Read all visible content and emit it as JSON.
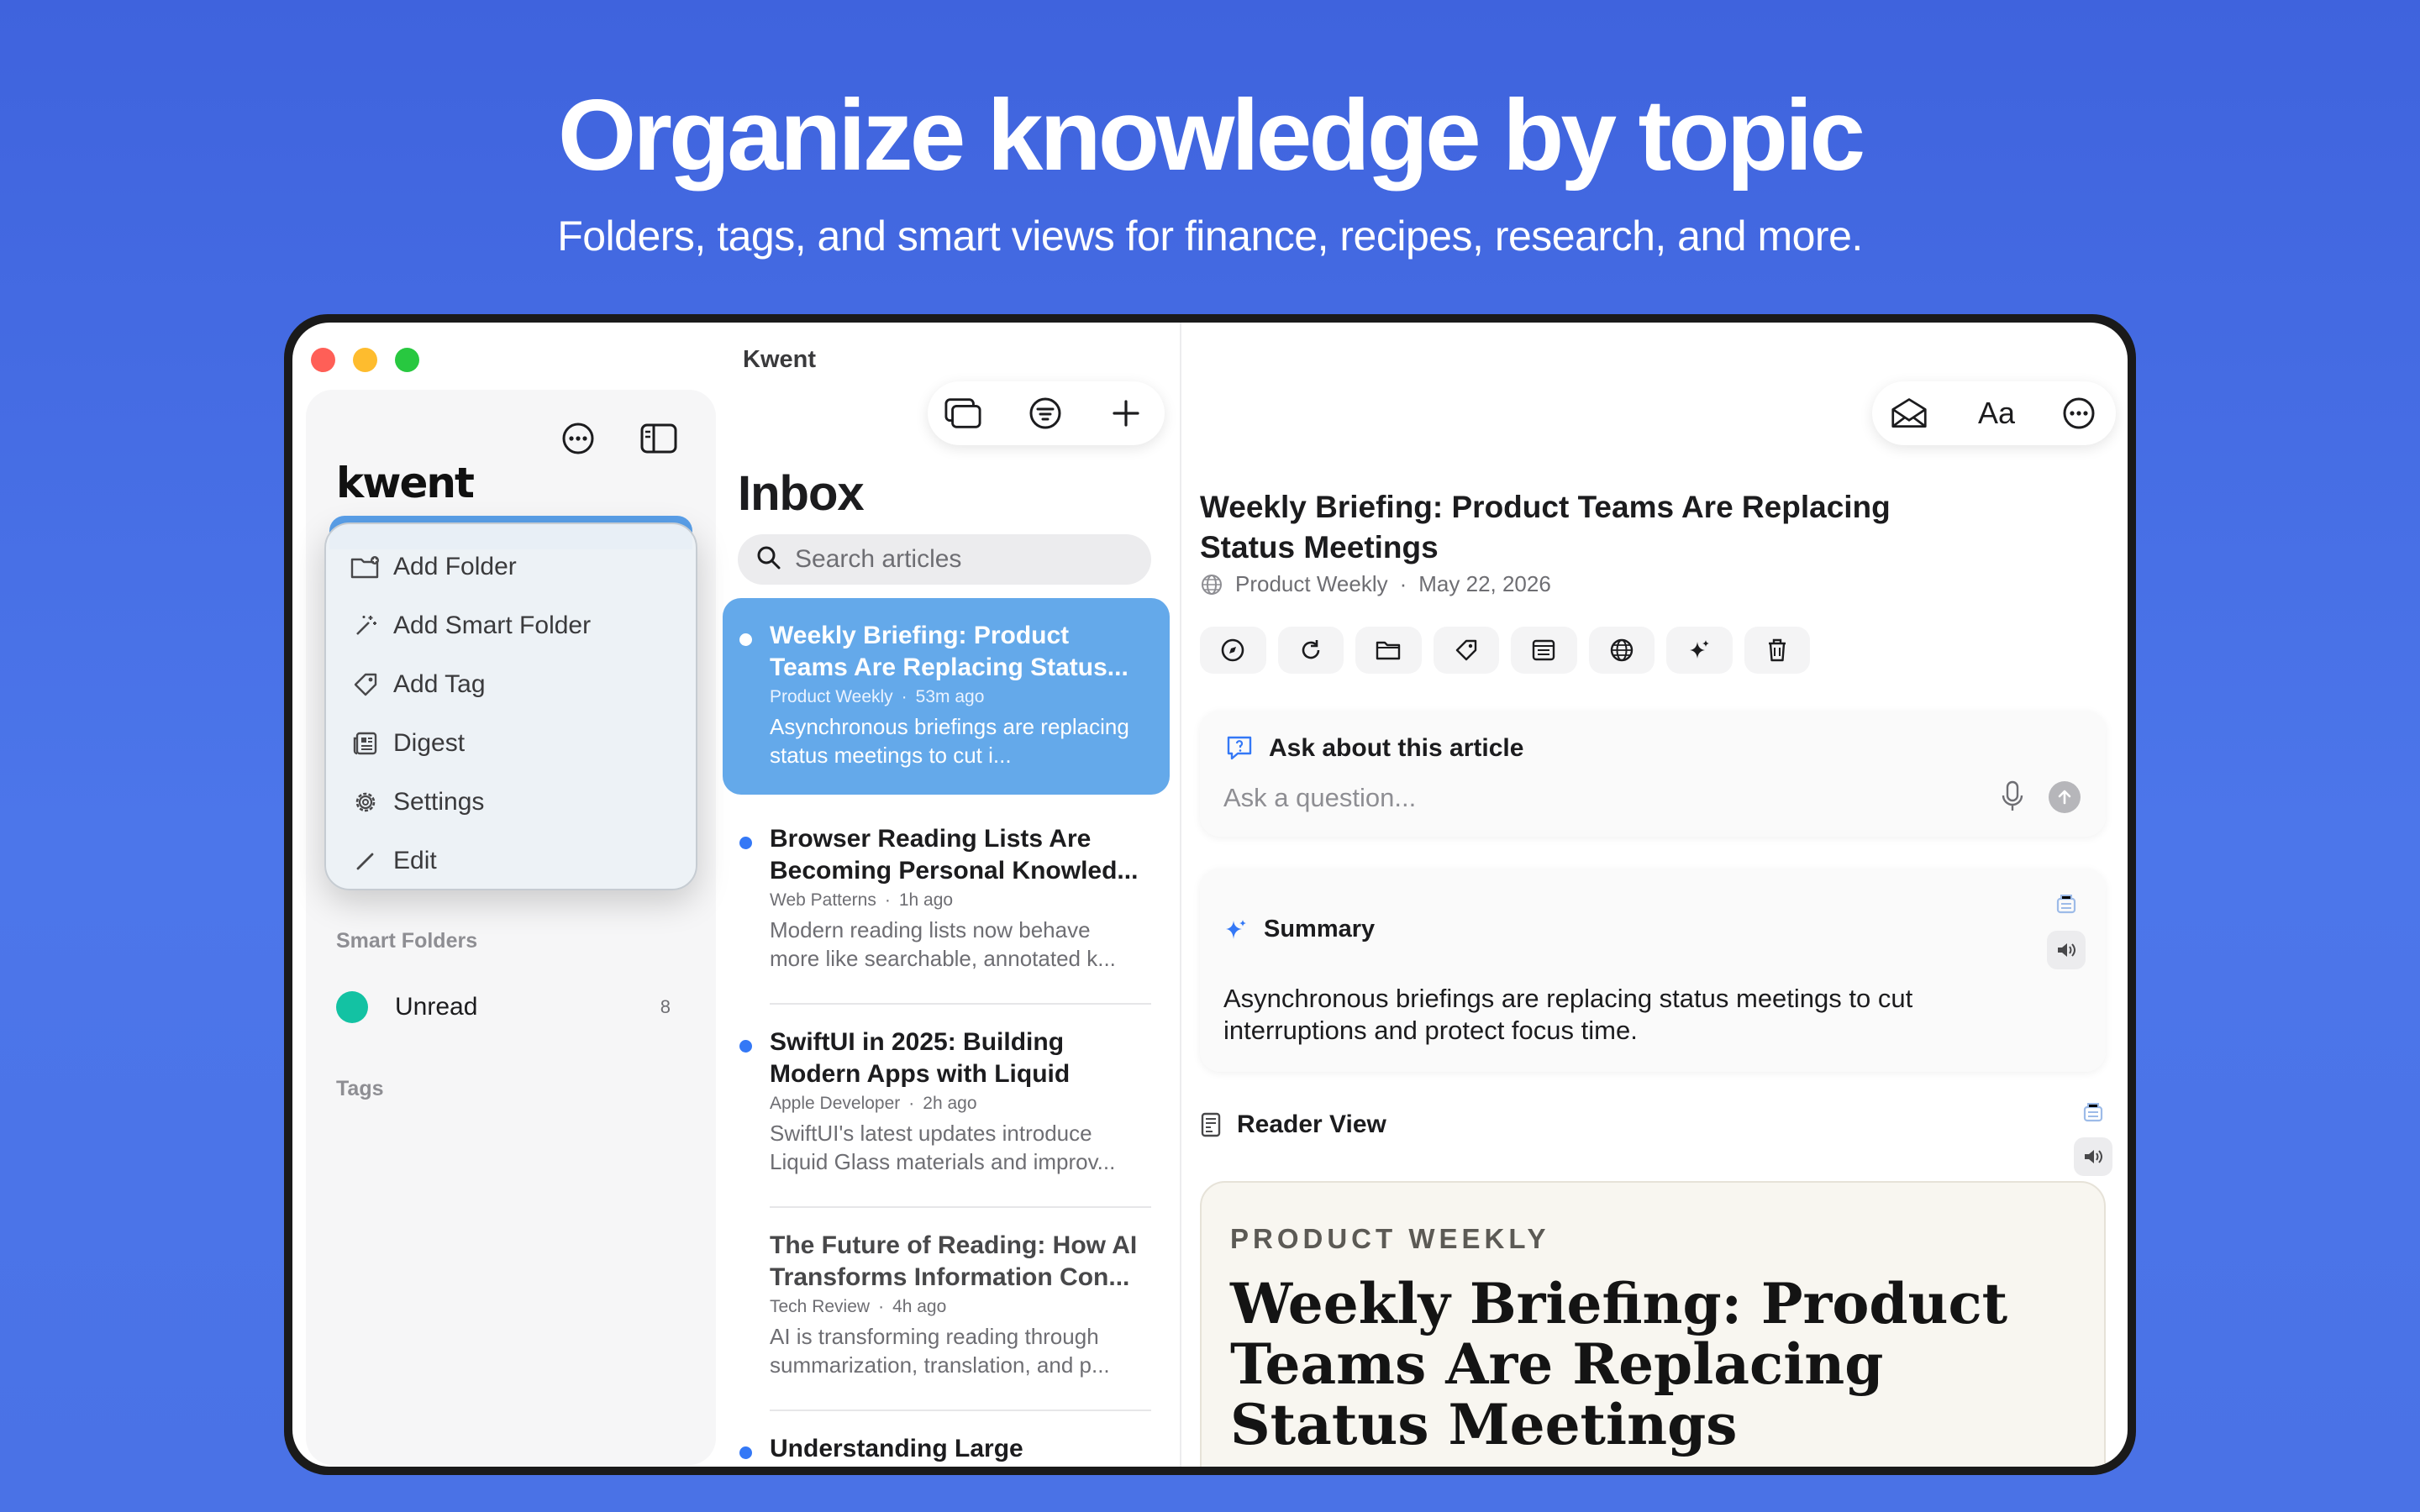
{
  "hero": {
    "headline": "Organize knowledge by topic",
    "subhead": "Folders, tags, and smart views for finance, recipes, research, and more."
  },
  "window": {
    "title": "Kwent"
  },
  "sidebar": {
    "logo": "kwent",
    "menu": [
      {
        "label": "Add Folder",
        "icon": "folder-add-icon"
      },
      {
        "label": "Add Smart Folder",
        "icon": "magic-wand-icon"
      },
      {
        "label": "Add Tag",
        "icon": "tag-icon"
      },
      {
        "label": "Digest",
        "icon": "newspaper-icon"
      },
      {
        "label": "Settings",
        "icon": "gear-icon"
      },
      {
        "label": "Edit",
        "icon": "pencil-icon"
      }
    ],
    "smart_folders_label": "Smart Folders",
    "smart_folders": [
      {
        "label": "Unread",
        "count": "8",
        "color": "#13c2a3"
      }
    ],
    "tags_label": "Tags"
  },
  "list": {
    "title": "Inbox",
    "search_placeholder": "Search articles",
    "articles": [
      {
        "title": "Weekly Briefing: Product Teams Are Replacing Status...",
        "source": "Product Weekly",
        "time": "53m ago",
        "excerpt": "Asynchronous briefings are replacing status meetings to cut i..."
      },
      {
        "title": "Browser Reading Lists Are Becoming Personal Knowled...",
        "source": "Web Patterns",
        "time": "1h ago",
        "excerpt": "Modern reading lists now behave more like searchable, annotated k..."
      },
      {
        "title": "SwiftUI in 2025: Building Modern Apps with Liquid Glass",
        "source": "Apple Developer",
        "time": "2h ago",
        "excerpt": "SwiftUI's latest updates introduce Liquid Glass materials and improv..."
      },
      {
        "title": "The Future of Reading: How AI Transforms Information Con...",
        "source": "Tech Review",
        "time": "4h ago",
        "excerpt": "AI is transforming reading through summarization, translation, and p..."
      },
      {
        "title": "Understanding Large",
        "source": "",
        "time": "",
        "excerpt": ""
      }
    ]
  },
  "detail": {
    "title": "Weekly Briefing: Product Teams Are Replacing Status Meetings",
    "source": "Product Weekly",
    "date": "May 22, 2026",
    "toolbar_text_button": "Aa",
    "ask": {
      "heading": "Ask about this article",
      "placeholder": "Ask a question..."
    },
    "summary": {
      "heading": "Summary",
      "text": "Asynchronous briefings are replacing status meetings to cut interruptions and protect focus time."
    },
    "reader": {
      "label": "Reader View",
      "source": "PRODUCT WEEKLY",
      "title": "Weekly Briefing: Product Teams Are Replacing Status Meetings"
    }
  },
  "colors": {
    "accent": "#3478f6",
    "selected_row": "#64a9ea",
    "unread_dot": "#13c2a3"
  }
}
